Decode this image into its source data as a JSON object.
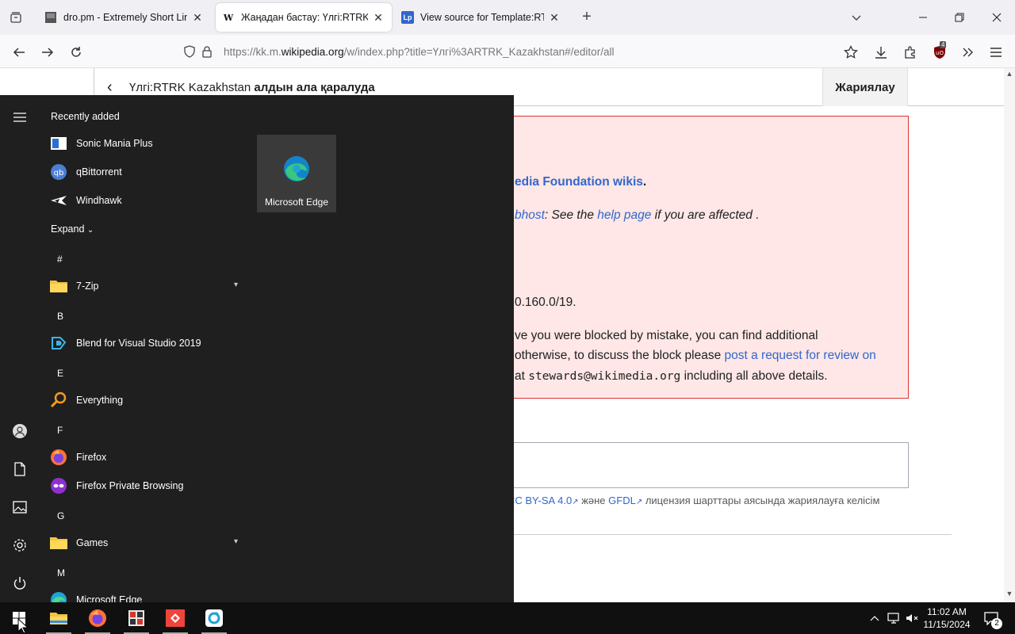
{
  "browser": {
    "tabs": [
      {
        "title": "dro.pm - Extremely Short Links",
        "favicon": "dro-favicon"
      },
      {
        "title": "Жаңадан бастау: Үлгі:RTRK Kaz",
        "favicon": "W"
      },
      {
        "title": "View source for Template:RTRK",
        "favicon": "Lp"
      }
    ],
    "url_prefix": "https://kk.m.",
    "url_domain": "wikipedia.org",
    "url_suffix": "/w/index.php?title=Үлгі%3ARTRK_Kazakhstan#/editor/all",
    "extension_badge": "4"
  },
  "editor": {
    "title_normal": "Үлгі:RTRK Kazakhstan",
    "title_bold": "алдын ала қаралуда",
    "publish_label": "Жариялау"
  },
  "error": {
    "line1_link": "edia Foundation wikis",
    "line1_end": ".",
    "line2_link1": "bhost",
    "line2_mid": ": See the ",
    "line2_link2": "help page",
    "line2_end": " if you are affected .",
    "line3": "0.160.0/19.",
    "line4": "ve you were blocked by mistake, you can find additional",
    "line5_start": "otherwise, to discuss the block please ",
    "line5_link": "post a request for review on",
    "line6_start": " at ",
    "line6_email": "stewards@wikimedia.org",
    "line6_end": " including all above details."
  },
  "license": {
    "link1": "CC BY-SA 4.0",
    "mid": " және ",
    "link2": "GFDL",
    "end": " лицензия шарттары аясында жариялауға келісім"
  },
  "start_menu": {
    "recently_added_label": "Recently added",
    "recent_apps": [
      "Sonic Mania Plus",
      "qBittorrent",
      "Windhawk"
    ],
    "expand_label": "Expand",
    "groups": [
      {
        "letter": "#",
        "apps": [
          "7-Zip"
        ]
      },
      {
        "letter": "B",
        "apps": [
          "Blend for Visual Studio 2019"
        ]
      },
      {
        "letter": "E",
        "apps": [
          "Everything"
        ]
      },
      {
        "letter": "F",
        "apps": [
          "Firefox",
          "Firefox Private Browsing"
        ]
      },
      {
        "letter": "G",
        "apps": [
          "Games"
        ]
      },
      {
        "letter": "M",
        "apps": [
          "Microsoft Edge"
        ]
      }
    ],
    "pinned_tile": "Microsoft Edge"
  },
  "taskbar": {
    "time": "11:02 AM",
    "date": "11/15/2024",
    "notification_count": "2"
  }
}
